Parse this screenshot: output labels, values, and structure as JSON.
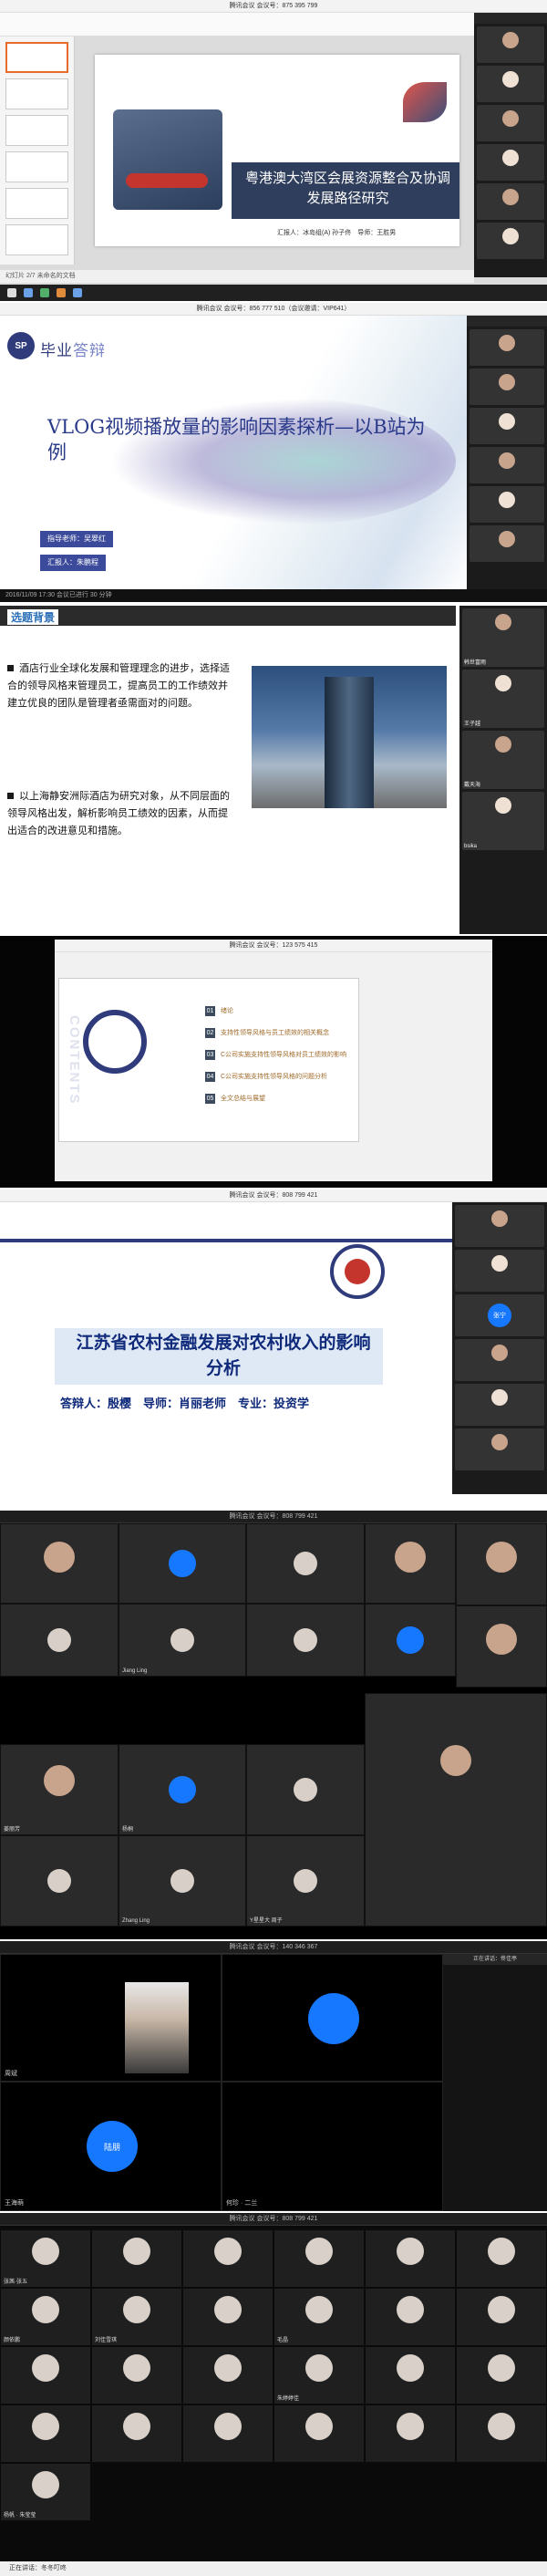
{
  "panels": {
    "p1": {
      "window_title": "腾讯会议 会议号：875 395 799",
      "status_bar": "幻灯片 2/7 未命名的文档",
      "slide_title": "粤港澳大湾区会展资源整合及协调发展路径研究",
      "slide_meta": "汇报人：冰岛组(A) 孙子佟　导师：王胜男",
      "participants": [
        "",
        "",
        "",
        "",
        "",
        "",
        ""
      ]
    },
    "p2": {
      "window_title": "腾讯会议 会议号：856 777 510（会议邀请：VIP641）",
      "brand_main": "毕业",
      "brand_highlight": "答辩",
      "slide_title": "VLOG视频播放量的影响因素探析—以B站为例",
      "advisor": "指导老师：吴翠红",
      "presenter": "汇报人：朱鹏程",
      "status_bar": "2016/11/09 17:30 会议已进行 30 分钟",
      "participants": [
        "",
        "",
        "",
        "",
        "",
        ""
      ]
    },
    "p3": {
      "section_title": "选题背景",
      "bullet1": "酒店行业全球化发展和管理理念的进步，选择适合的领导风格来管理员工，提高员工的工作绩效并建立优良的团队是管理者亟需面对的问题。",
      "bullet2": "以上海静安洲际酒店为研究对象，从不同层面的领导风格出发，解析影响员工绩效的因素，从而提出适合的改进意见和措施。",
      "participants": [
        "韩世富雨",
        "王子越",
        "戴天海",
        "bsika"
      ]
    },
    "p4": {
      "window_title": "腾讯会议 会议号：123 575 415",
      "contents_label": "CONTENTS",
      "items": [
        {
          "num": "01",
          "label": "绪论"
        },
        {
          "num": "02",
          "label": "支持性领导风格与员工绩效的相关概念"
        },
        {
          "num": "03",
          "label": "C公司实施支持性领导风格对员工绩效的影响"
        },
        {
          "num": "04",
          "label": "C公司实施支持性领导风格的问题分析"
        },
        {
          "num": "05",
          "label": "全文总结与展望"
        }
      ]
    },
    "p5": {
      "window_title": "腾讯会议 会议号：808 799 421",
      "slide_title": "江苏省农村金融发展对农村收入的影响分析",
      "meta": "答辩人：殷樱　导师：肖丽老师　专业：投资学",
      "participants": [
        "",
        "",
        "张宁",
        "",
        "",
        ""
      ]
    },
    "p6": {
      "window_title": "腾讯会议 会议号：808 799 421",
      "tiles_top": [
        "",
        "",
        "",
        "",
        "",
        "Jiang Ling",
        "",
        ""
      ],
      "tiles_bottom": [
        "姜丽芳",
        "杨桐",
        "",
        "",
        "Zhang Ling",
        "",
        "Y星星大 周子"
      ]
    },
    "p7": {
      "window_title": "腾讯会议 会议号：140 346 367",
      "tiles": [
        "周斌",
        "",
        "陆朋",
        "",
        "王海萌",
        "何珍 · 二兰"
      ],
      "side_title": "正在讲话：佟佳亭"
    },
    "p8": {
      "window_title": "腾讯会议 会议号：808 799 421",
      "names": [
        "张茜·张五",
        "",
        "",
        "",
        "",
        "",
        "颜依鹏",
        "刘佳雪琪",
        "",
        "毛晶",
        "",
        "",
        "",
        "",
        "",
        "朱婷婷佳",
        "",
        "",
        "",
        "",
        "",
        "",
        "",
        "",
        "杨帆 · 朱莹莹"
      ],
      "taskbar": "正在讲话：冬冬叮咚",
      "statusbar": "正在讲话"
    }
  }
}
